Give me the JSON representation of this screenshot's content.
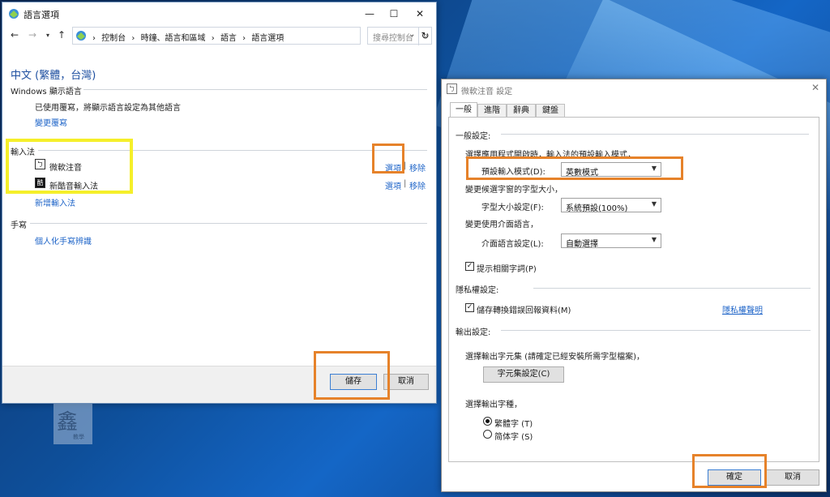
{
  "window1": {
    "title": "語言選項",
    "breadcrumbs": [
      "控制台",
      "時鐘、語言和區域",
      "語言",
      "語言選項"
    ],
    "search_placeholder": "搜尋控制台",
    "language_name": "中文 (繁體，台灣)",
    "windows_display": {
      "heading": "Windows 顯示語言",
      "status": "已使用覆寫，將顯示語言設定為其他語言",
      "change_link": "變更覆寫"
    },
    "input_methods": {
      "heading": "輸入法",
      "items": [
        {
          "name": "微軟注音",
          "options_label": "選項",
          "remove_label": "移除"
        },
        {
          "name": "新酷音輸入法",
          "options_label": "選項",
          "remove_label": "移除"
        }
      ],
      "add_link": "新增輸入法"
    },
    "handwriting": {
      "heading": "手寫",
      "personalize_link": "個人化手寫辨識"
    },
    "save_label": "儲存",
    "cancel_label": "取消"
  },
  "window2": {
    "title": "微軟注音 設定",
    "tabs": [
      "一般",
      "進階",
      "辭典",
      "鍵盤"
    ],
    "general": {
      "heading": "一般設定:",
      "mode_desc": "選擇應用程式開啟時，輸入法的預設輸入模式，",
      "mode_label": "預設輸入模式(D):",
      "mode_value": "英數模式",
      "font_desc": "變更候選字窗的字型大小，",
      "font_label": "字型大小設定(F):",
      "font_value": "系統預設(100%)",
      "ui_desc": "變更使用介面語言，",
      "ui_label": "介面語言設定(L):",
      "ui_value": "自動選擇",
      "hint_label": "提示相關字詞(P)",
      "hint_checked": true
    },
    "privacy": {
      "heading": "隱私權設定:",
      "save_label": "儲存轉換錯誤回報資料(M)",
      "save_checked": true,
      "statement_link": "隱私權聲明"
    },
    "output": {
      "heading": "輸出設定:",
      "charset_desc": "選擇輸出字元集 (請確定已經安裝所需字型檔案)，",
      "charset_button": "字元集設定(C)",
      "chartype_desc": "選擇輸出字種，",
      "traditional_label": "繁體字 (T)",
      "simplified_label": "简体字 (S)",
      "selected": "traditional"
    },
    "ok_label": "確定",
    "cancel_label": "取消"
  },
  "watermark": {
    "big": "鑫",
    "small": "教學"
  },
  "colors": {
    "highlight_yellow": "#f5ef2a",
    "highlight_orange": "#e6822a",
    "link": "#1e64c8"
  }
}
